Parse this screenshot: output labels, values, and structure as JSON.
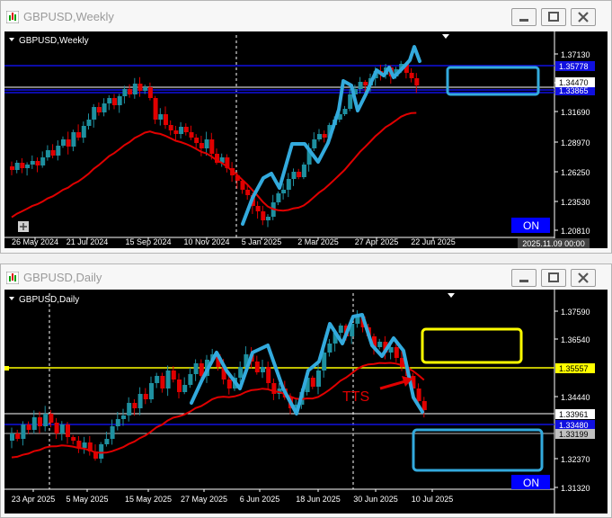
{
  "windows": [
    {
      "title": "GBPUSD,Weekly",
      "symbol_label": "GBPUSD,Weekly",
      "on_button": "ON",
      "date_readout": "2025.11.09 00:00",
      "x_labels": [
        "26 May 2024",
        "21 Jul 2024",
        "15 Sep 2024",
        "10 Nov 2024",
        "5 Jan 2025",
        "2 Mar 2025",
        "27 Apr 2025",
        "22 Jun 2025"
      ],
      "y_labels": [
        "1.37130",
        "1.34410",
        "1.31690",
        "1.28970",
        "1.26250",
        "1.23530",
        "1.20810"
      ],
      "price_tags": [
        {
          "text": "1.35778",
          "color": "#1010e0"
        },
        {
          "text": "1.33865",
          "color": "#1010e0"
        },
        {
          "text": "1.34470",
          "color": "#ffffff"
        }
      ]
    },
    {
      "title": "GBPUSD,Daily",
      "symbol_label": "GBPUSD,Daily",
      "on_button": "ON",
      "annotation": "TTS",
      "x_labels": [
        "23 Apr 2025",
        "5 May 2025",
        "15 May 2025",
        "27 May 2025",
        "6 Jun 2025",
        "18 Jun 2025",
        "30 Jun 2025",
        "10 Jul 2025"
      ],
      "y_labels": [
        "1.37590",
        "1.36540",
        "1.34440",
        "1.32370",
        "1.31320"
      ],
      "price_tags": [
        {
          "text": "1.35557",
          "color": "#ffff00"
        },
        {
          "text": "1.33961",
          "color": "#ffffff"
        },
        {
          "text": "1.33480",
          "color": "#1010e0"
        },
        {
          "text": "1.33199",
          "color": "#c0c0c0"
        }
      ]
    }
  ],
  "colors": {
    "bull_candle": "#1e90a0",
    "bear_candle": "#e00000",
    "moving_average": "#e00000",
    "trend_drawing": "#33aadd",
    "resistance_line": "#ffff00",
    "support_line": "#0000ff",
    "on_button": "#0000ff"
  }
}
